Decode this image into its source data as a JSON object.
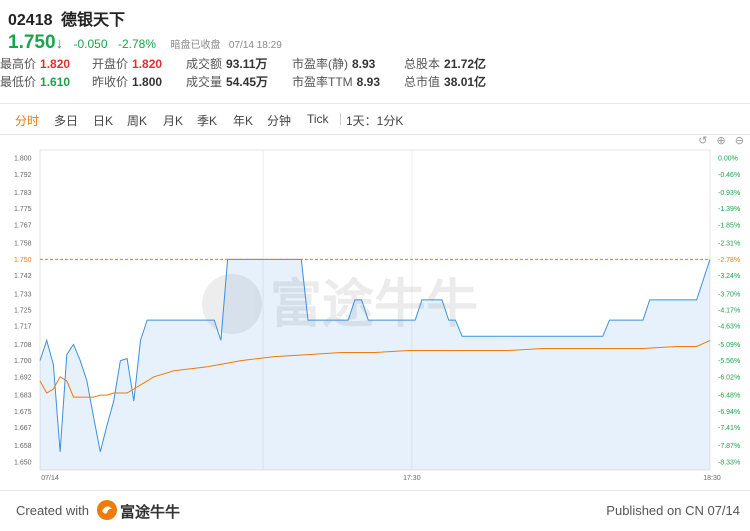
{
  "header": {
    "code": "02418",
    "name": "德银天下",
    "price": "1.750",
    "change": "-0.050",
    "change_pct": "-2.78%",
    "status": "暗盘已收盘",
    "datetime": "07/14 18:29"
  },
  "quotes": [
    {
      "label": "最高价",
      "value": "1.820",
      "color": "red"
    },
    {
      "label": "开盘价",
      "value": "1.820",
      "color": "red"
    },
    {
      "label": "成交额",
      "value": "93.11万",
      "color": "none"
    },
    {
      "label": "市盈率(静)",
      "value": "8.93",
      "color": "none"
    },
    {
      "label": "总股本",
      "value": "21.72亿",
      "color": "none"
    },
    {
      "label": "最低价",
      "value": "1.610",
      "color": "green"
    },
    {
      "label": "昨收价",
      "value": "1.800",
      "color": "none"
    },
    {
      "label": "成交量",
      "value": "54.45万",
      "color": "none"
    },
    {
      "label": "市盈率TTM",
      "value": "8.93",
      "color": "none"
    },
    {
      "label": "总市值",
      "value": "38.01亿",
      "color": "none"
    }
  ],
  "tabs": [
    "分时",
    "多日",
    "日K",
    "周K",
    "月K",
    "季K",
    "年K",
    "分钟",
    "Tick",
    "1天：1分K"
  ],
  "active_tab": "分时",
  "icons": {
    "reset": "undo-icon",
    "zoom_in": "zoom-in-icon",
    "zoom_out": "zoom-out-icon"
  },
  "watermark": "富途牛牛",
  "footer": {
    "created_with": "Created with",
    "logo_text": "富途牛牛",
    "published": "Published on CN 07/14"
  },
  "colors": {
    "up": "#e03030",
    "down": "#19a34a",
    "accent": "#f07a0a",
    "price_line": "#3d8fe0",
    "avg_line": "#f07a0a"
  },
  "chart_data": {
    "type": "line",
    "x_labels": [
      "07/14",
      "17:30",
      "18:30"
    ],
    "y_left_ticks": [
      "1.800",
      "1.792",
      "1.783",
      "1.775",
      "1.767",
      "1.758",
      "1.750",
      "1.742",
      "1.733",
      "1.725",
      "1.717",
      "1.708",
      "1.700",
      "1.692",
      "1.683",
      "1.675",
      "1.667",
      "1.658",
      "1.650"
    ],
    "y_right_ticks": [
      "0.00%",
      "-0.46%",
      "-0.93%",
      "-1.39%",
      "-1.85%",
      "-2.31%",
      "-2.78%",
      "-3.24%",
      "-3.70%",
      "-4.17%",
      "-4.63%",
      "-5.09%",
      "-5.56%",
      "-6.02%",
      "-6.48%",
      "-6.94%",
      "-7.41%",
      "-7.87%",
      "-8.33%"
    ],
    "ylim": [
      1.646,
      1.804
    ],
    "highlight_price": 1.75,
    "highlight_label": "1.750",
    "highlight_pct": "-2.78%",
    "series": [
      {
        "kind": "price",
        "x": [
          0,
          1,
          2,
          3,
          4,
          5,
          6,
          7,
          8,
          9,
          10,
          11,
          12,
          13,
          14,
          15,
          16,
          17,
          18,
          19,
          20,
          21,
          22,
          23,
          24,
          25,
          26,
          27,
          28,
          29,
          30,
          31,
          32,
          33,
          34,
          35,
          36,
          37,
          38,
          39,
          40,
          41,
          42,
          43,
          44,
          45,
          46,
          47,
          48,
          49,
          50,
          51,
          52,
          53,
          54,
          55,
          56,
          57,
          58,
          59,
          60,
          61,
          62,
          63,
          64,
          65,
          66,
          67,
          68,
          69,
          70,
          71,
          72,
          73,
          74,
          75,
          76,
          77,
          78,
          79,
          80,
          81,
          82,
          83,
          84,
          85,
          86,
          87,
          88,
          89,
          90,
          91,
          92,
          93,
          94,
          95,
          96,
          97,
          98,
          99,
          100
        ],
        "values": [
          1.7,
          1.71,
          1.698,
          1.655,
          1.703,
          1.708,
          1.7,
          1.69,
          1.672,
          1.655,
          1.668,
          1.68,
          1.7,
          1.701,
          1.68,
          1.71,
          1.72,
          1.72,
          1.72,
          1.72,
          1.72,
          1.72,
          1.72,
          1.72,
          1.72,
          1.72,
          1.72,
          1.71,
          1.75,
          1.75,
          1.75,
          1.75,
          1.75,
          1.75,
          1.75,
          1.75,
          1.75,
          1.75,
          1.75,
          1.75,
          1.72,
          1.72,
          1.72,
          1.72,
          1.72,
          1.72,
          1.72,
          1.73,
          1.73,
          1.72,
          1.72,
          1.72,
          1.72,
          1.72,
          1.72,
          1.72,
          1.72,
          1.73,
          1.73,
          1.73,
          1.73,
          1.72,
          1.72,
          1.712,
          1.712,
          1.712,
          1.712,
          1.712,
          1.712,
          1.712,
          1.712,
          1.712,
          1.712,
          1.712,
          1.712,
          1.712,
          1.712,
          1.712,
          1.712,
          1.712,
          1.712,
          1.712,
          1.712,
          1.712,
          1.712,
          1.72,
          1.72,
          1.72,
          1.72,
          1.72,
          1.72,
          1.73,
          1.73,
          1.73,
          1.73,
          1.73,
          1.73,
          1.73,
          1.73,
          1.74,
          1.75
        ]
      },
      {
        "kind": "avg",
        "x": [
          0,
          1,
          2,
          3,
          4,
          5,
          6,
          7,
          8,
          9,
          10,
          11,
          12,
          13,
          14,
          15,
          16,
          17,
          18,
          19,
          20,
          25,
          30,
          35,
          40,
          45,
          50,
          55,
          60,
          65,
          70,
          75,
          80,
          85,
          90,
          95,
          98,
          100
        ],
        "values": [
          1.69,
          1.684,
          1.686,
          1.692,
          1.69,
          1.682,
          1.682,
          1.682,
          1.682,
          1.683,
          1.683,
          1.684,
          1.684,
          1.684,
          1.686,
          1.688,
          1.69,
          1.692,
          1.693,
          1.694,
          1.695,
          1.697,
          1.7,
          1.702,
          1.703,
          1.704,
          1.704,
          1.705,
          1.705,
          1.705,
          1.705,
          1.706,
          1.706,
          1.706,
          1.706,
          1.707,
          1.707,
          1.71
        ]
      }
    ]
  }
}
